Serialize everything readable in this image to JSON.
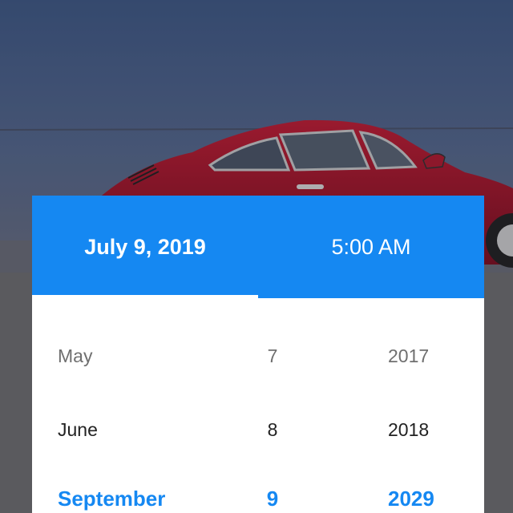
{
  "header": {
    "date_tab": "July 9, 2019",
    "time_tab": "5:00 AM"
  },
  "wheel": {
    "rows": [
      {
        "month": "May",
        "day": "7",
        "year": "2017"
      },
      {
        "month": "June",
        "day": "8",
        "year": "2018"
      },
      {
        "month": "September",
        "day": "9",
        "year": "2029"
      }
    ]
  },
  "colors": {
    "accent": "#1588f2",
    "card": "#ffffff",
    "car_body": "#b0182e",
    "sky": "#3f5985"
  }
}
